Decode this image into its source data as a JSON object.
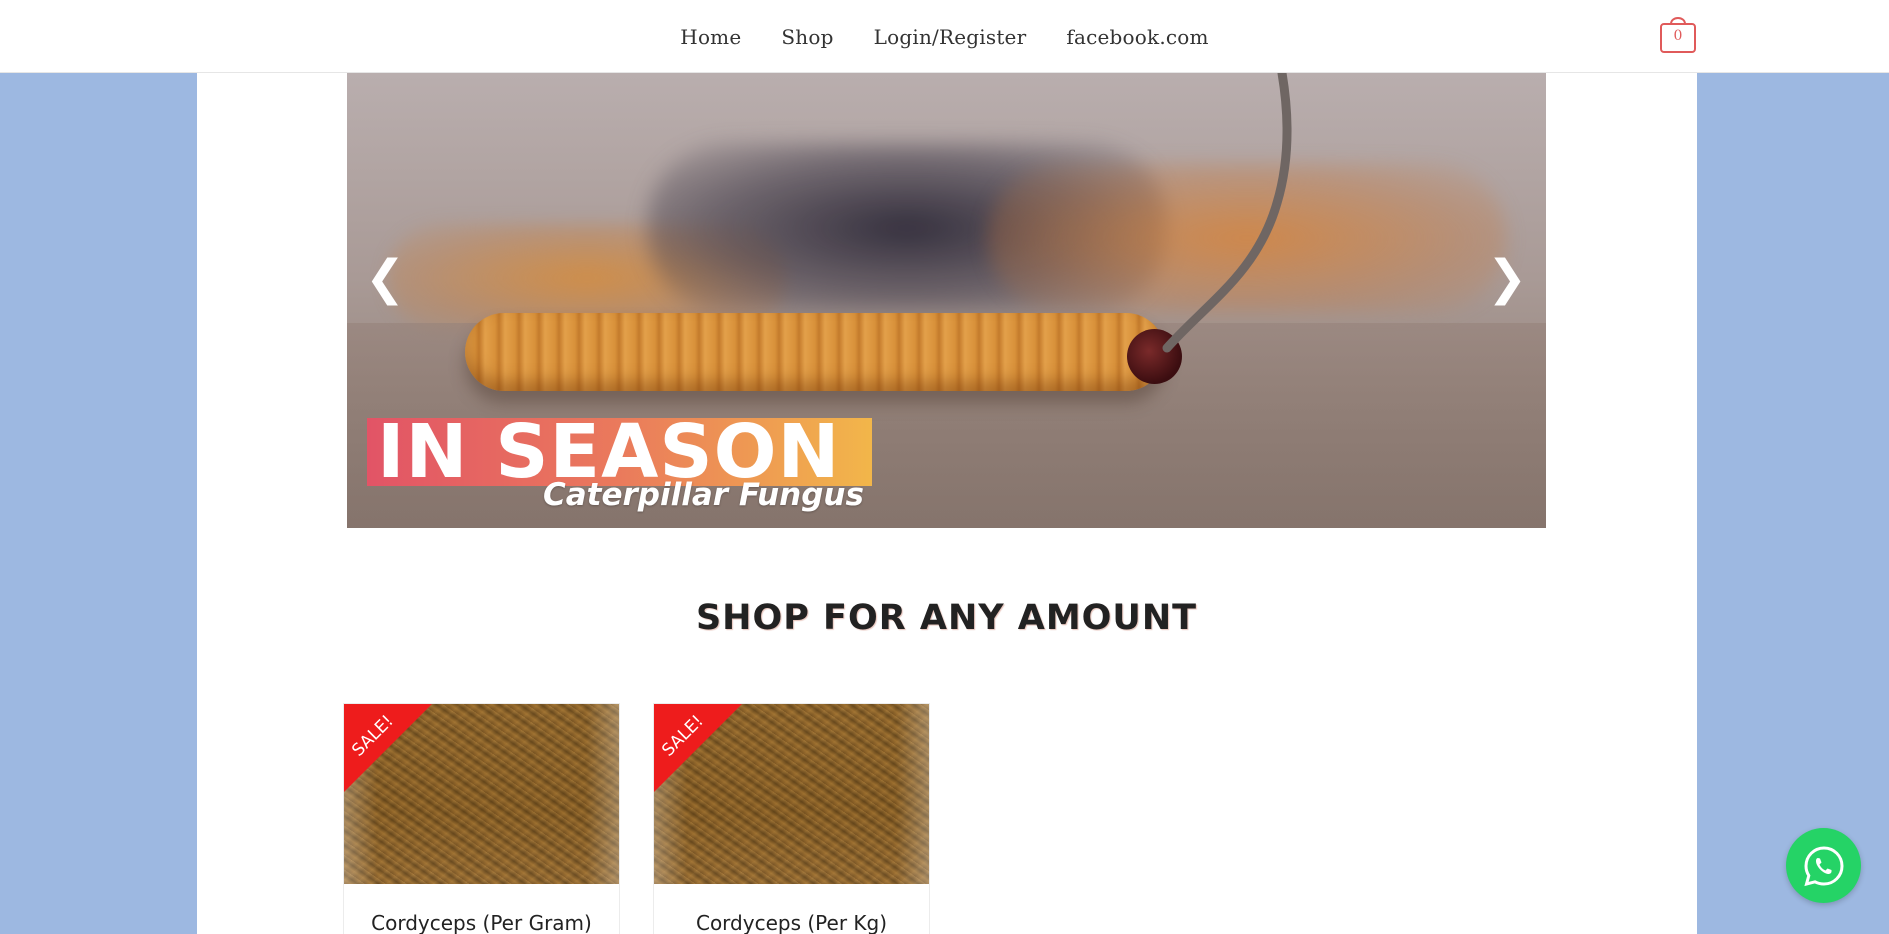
{
  "header": {
    "nav": [
      {
        "label": "Home"
      },
      {
        "label": "Shop"
      },
      {
        "label": "Login/Register"
      },
      {
        "label": "facebook.com"
      }
    ],
    "cart": {
      "count": "0",
      "icon": "shopping-bag-icon",
      "color": "#e05a5a"
    }
  },
  "slider": {
    "headline": "IN SEASON",
    "subline": "Caterpillar Fungus",
    "prev_glyph": "❮",
    "next_glyph": "❯"
  },
  "section": {
    "title": "SHOP FOR ANY AMOUNT"
  },
  "products": [
    {
      "badge": "SALE!",
      "title": "Cordyceps (Per Gram)"
    },
    {
      "badge": "SALE!",
      "title": "Cordyceps (Per Kg)"
    }
  ],
  "whatsapp": {
    "icon": "whatsapp-icon",
    "color": "#25d366"
  },
  "colors": {
    "background": "#9db8e1",
    "panel": "#ffffff",
    "sale_badge": "#ee1c1c",
    "accent": "#e05a5a"
  }
}
